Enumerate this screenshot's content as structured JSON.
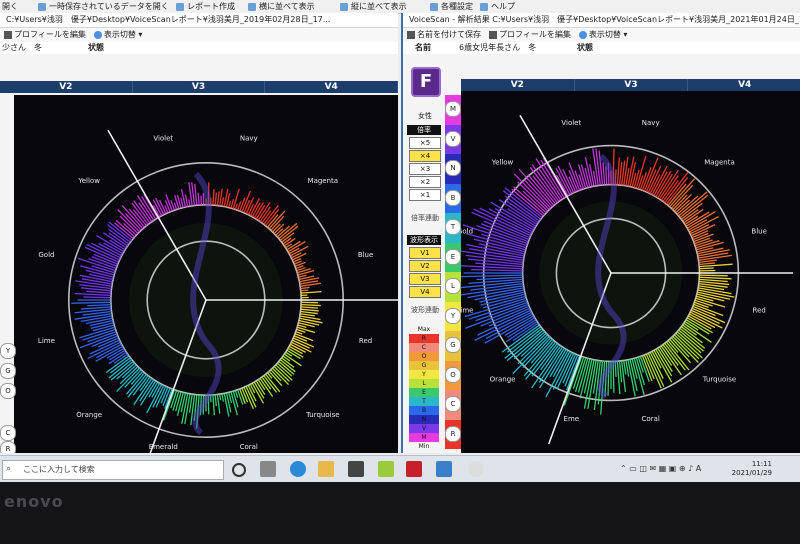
{
  "topbar": {
    "items": [
      "開く",
      "一時保存されているデータを開く",
      "レポート作成",
      "横に並べて表示",
      "縦に並べて表示",
      "各種設定",
      "ヘルプ"
    ]
  },
  "left_window": {
    "title": "C:¥Users¥浅羽　優子¥Desktop¥VoiceScanレポート¥浅羽美月_2019年02月28日_17...",
    "toolbar": [
      "プロフィールを編集",
      "表示切替"
    ],
    "name_value": "少さん　冬",
    "status_label": "状態",
    "v_headers": [
      "V2",
      "V3",
      "V4"
    ],
    "colors": [
      "Violet",
      "Navy",
      "Magenta",
      "Blue",
      "Red",
      "Turquoise",
      "Coral",
      "Emerald",
      "Orange",
      "Lime",
      "Gold",
      "Yellow"
    ],
    "side_letters": [
      "Y",
      "G",
      "O",
      "C",
      "R"
    ]
  },
  "right_window": {
    "title": "VoiceScan - 解析結果 C:¥Users¥浅羽　優子¥Desktop¥VoiceScanレポート¥浅羽美月_2021年01月24日_12...",
    "toolbar": [
      "名前を付けて保存",
      "プロフィールを編集",
      "表示切替"
    ],
    "name_label": "名前",
    "name_value": "6歳女児年長さん　冬",
    "status_label": "状態",
    "v_headers": [
      "V2",
      "V3",
      "V4"
    ],
    "colors": [
      "Violet",
      "Navy",
      "Magenta",
      "Blue",
      "Red",
      "Turquoise",
      "Coral",
      "Eme",
      "Orange",
      "Lime",
      "Gold",
      "Yellow"
    ],
    "sidebar": {
      "f_button": "F",
      "gender": "女性",
      "magnification_head": "倍率",
      "magnification": [
        "×5",
        "×4",
        "×3",
        "×2",
        "×1"
      ],
      "magnification_link": "倍率連動",
      "wave_head": "波形表示",
      "wave": [
        "V1",
        "V2",
        "V3",
        "V4"
      ],
      "wave_link": "波形連動",
      "legend_max": "Max",
      "legend": [
        "R",
        "C",
        "O",
        "G",
        "Y",
        "L",
        "E",
        "T",
        "B",
        "N",
        "V",
        "M"
      ],
      "legend_min": "Min",
      "strip_letters": [
        "M",
        "V",
        "N",
        "B",
        "T",
        "E",
        "L",
        "Y",
        "G",
        "O",
        "C",
        "R"
      ]
    }
  },
  "taskbar": {
    "search_placeholder": "ここに入力して検索",
    "time": "11:11",
    "date": "2021/01/29"
  },
  "bezel": {
    "brand": "enovo"
  }
}
